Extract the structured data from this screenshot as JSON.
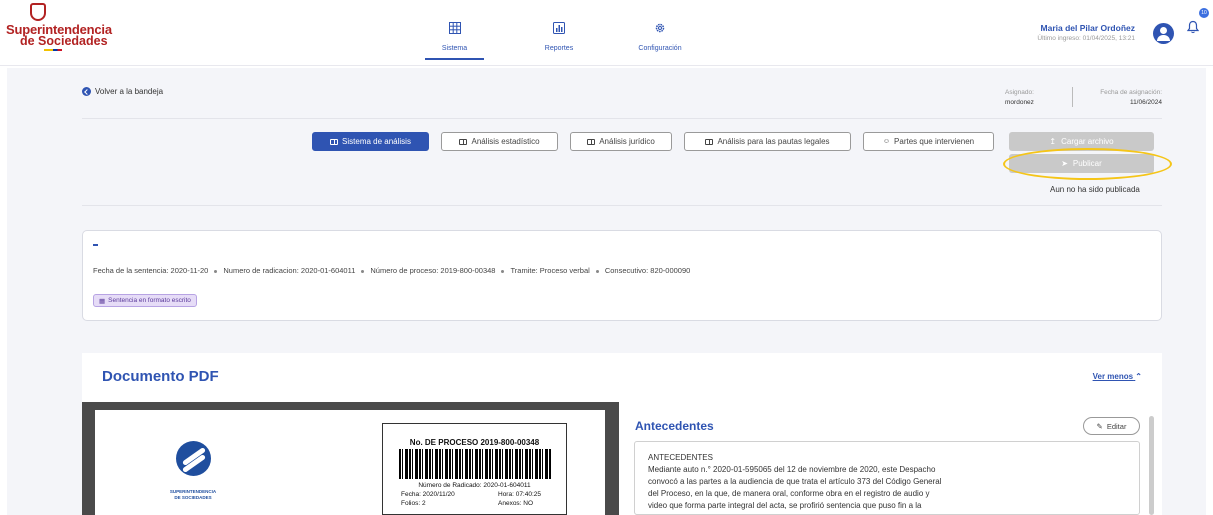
{
  "header": {
    "logo_line1": "Superintendencia",
    "logo_line2": "de Sociedades",
    "nav": [
      {
        "label": "Sistema",
        "icon": "grid-icon",
        "active": true
      },
      {
        "label": "Reportes",
        "icon": "chart-icon",
        "active": false
      },
      {
        "label": "Configuración",
        "icon": "gear-icon",
        "active": false
      }
    ],
    "user_name": "Maria del Pilar Ordoñez",
    "last_login": "Último ingreso: 01/04/2025, 13:21",
    "notif_count": "10"
  },
  "toolbar": {
    "back_label": "Volver a la bandeja",
    "assigned_label": "Asignado:",
    "assigned_value": "mordonez",
    "date_label": "Fecha de asignación:",
    "date_value": "11/06/2024"
  },
  "tabs": [
    {
      "label": "Sistema de análisis",
      "active": true
    },
    {
      "label": "Análisis estadístico",
      "active": false
    },
    {
      "label": "Análisis jurídico",
      "active": false
    },
    {
      "label": "Análisis para las pautas legales",
      "active": false
    },
    {
      "label": "Partes que intervienen",
      "active": false
    }
  ],
  "actions": {
    "upload_label": "Cargar archivo",
    "publish_label": "Publicar",
    "publish_note": "Aun no ha sido publicada"
  },
  "case": {
    "title": "-",
    "meta": [
      "Fecha de la sentencia: 2020-11-20",
      "Numero de radicacion: 2020-01-604011",
      "Número de proceso: 2019-800-00348",
      "Tramite: Proceso verbal",
      "Consecutivo: 820-000090"
    ],
    "chip": "Sentencia en formato escrito"
  },
  "document": {
    "title": "Documento PDF",
    "toggle": "Ver menos",
    "pdf": {
      "logo_text1": "SUPERINTENDENCIA",
      "logo_text2": "DE SOCIEDADES",
      "proceso": "No. DE PROCESO  2019-800-00348",
      "radicado": "Número de Radicado: 2020-01-604011",
      "fecha": "Fecha: 2020/11/20",
      "hora": "Hora: 07:40:25",
      "folios": "Folios: 2",
      "anexos": "Anexos: NO"
    }
  },
  "antecedentes": {
    "title": "Antecedentes",
    "edit_label": "Editar",
    "heading": "ANTECEDENTES",
    "lines": [
      "Mediante auto n.° 2020-01-595065 del 12 de noviembre de 2020, este Despacho",
      "convocó a las partes a la audiencia de que trata el artículo 373 del Código General",
      "del Proceso, en la que, de manera oral, conforme obra en el registro de audio y",
      "video que forma parte integral del acta, se profirió sentencia que puso fin a la"
    ]
  }
}
